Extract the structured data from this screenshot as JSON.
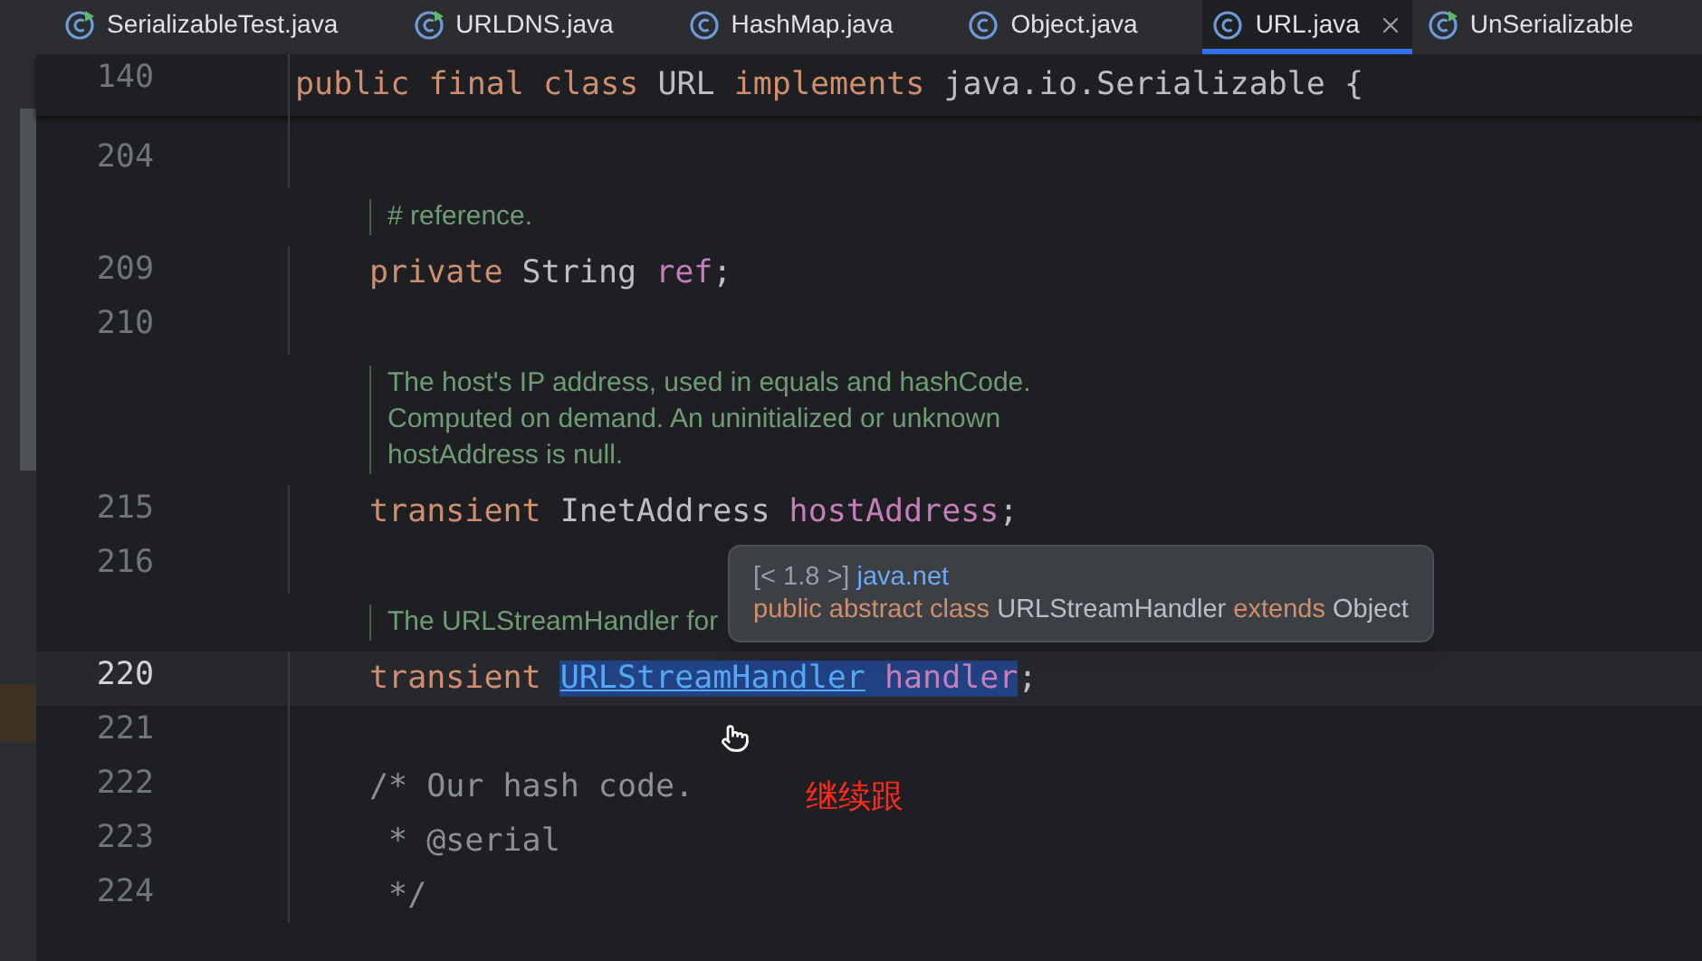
{
  "tabs": [
    {
      "label": "SerializableTest.java",
      "selected": false,
      "runnable": true
    },
    {
      "label": "URLDNS.java",
      "selected": false,
      "runnable": true
    },
    {
      "label": "HashMap.java",
      "selected": false,
      "runnable": false
    },
    {
      "label": "Object.java",
      "selected": false,
      "runnable": false
    },
    {
      "label": "URL.java",
      "selected": true,
      "runnable": false
    },
    {
      "label": "UnSerializable",
      "selected": false,
      "runnable": true
    }
  ],
  "sticky_line": {
    "number": "140",
    "tokens": [
      {
        "text": "public final class ",
        "kind": "keyword"
      },
      {
        "text": "URL ",
        "kind": "plain"
      },
      {
        "text": "implements ",
        "kind": "keyword"
      },
      {
        "text": "java.io.Serializable {",
        "kind": "plain"
      }
    ]
  },
  "lines": [
    {
      "kind": "code",
      "number": "204",
      "current": false
    },
    {
      "kind": "doc",
      "lines": [
        "# reference."
      ]
    },
    {
      "kind": "code",
      "number": "209",
      "current": false,
      "tokens": [
        {
          "text": "private ",
          "kind": "keyword"
        },
        {
          "text": "String ",
          "kind": "plain"
        },
        {
          "text": "ref",
          "kind": "field"
        },
        {
          "text": ";",
          "kind": "plain"
        }
      ]
    },
    {
      "kind": "code",
      "number": "210",
      "current": false
    },
    {
      "kind": "doc",
      "lines": [
        "The host's IP address, used in equals and hashCode.",
        "Computed on demand. An uninitialized or unknown",
        "hostAddress is null."
      ]
    },
    {
      "kind": "code",
      "number": "215",
      "current": false,
      "tokens": [
        {
          "text": "transient ",
          "kind": "keyword"
        },
        {
          "text": "InetAddress ",
          "kind": "plain"
        },
        {
          "text": "hostAddress",
          "kind": "field"
        },
        {
          "text": ";",
          "kind": "plain"
        }
      ]
    },
    {
      "kind": "code",
      "number": "216",
      "current": false
    },
    {
      "kind": "doc",
      "lines": [
        "The URLStreamHandler for"
      ]
    },
    {
      "kind": "code",
      "number": "220",
      "current": true,
      "tokens": [
        {
          "text": "transient ",
          "kind": "keyword"
        },
        {
          "text": "URLStreamHandler",
          "kind": "link",
          "selected": true
        },
        {
          "text": " handler",
          "kind": "field",
          "selected": true
        },
        {
          "text": ";",
          "kind": "plain"
        }
      ]
    },
    {
      "kind": "code",
      "number": "221",
      "current": false
    },
    {
      "kind": "code",
      "number": "222",
      "current": false,
      "tokens": [
        {
          "text": "/* Our hash code.",
          "kind": "comment"
        }
      ]
    },
    {
      "kind": "code",
      "number": "223",
      "current": false,
      "tokens": [
        {
          "text": " * @serial",
          "kind": "comment"
        }
      ]
    },
    {
      "kind": "code",
      "number": "224",
      "current": false,
      "tokens": [
        {
          "text": " */",
          "kind": "comment"
        }
      ]
    }
  ],
  "tooltip": {
    "lines": [
      [
        {
          "text": "[< 1.8 >] ",
          "kind": "muted"
        },
        {
          "text": "java.net",
          "kind": "package"
        }
      ],
      [
        {
          "text": "public abstract class ",
          "kind": "keyword"
        },
        {
          "text": "URLStreamHandler ",
          "kind": "plain"
        },
        {
          "text": "extends ",
          "kind": "keyword"
        },
        {
          "text": "Object",
          "kind": "plain"
        }
      ]
    ]
  },
  "annotation": "继续跟"
}
